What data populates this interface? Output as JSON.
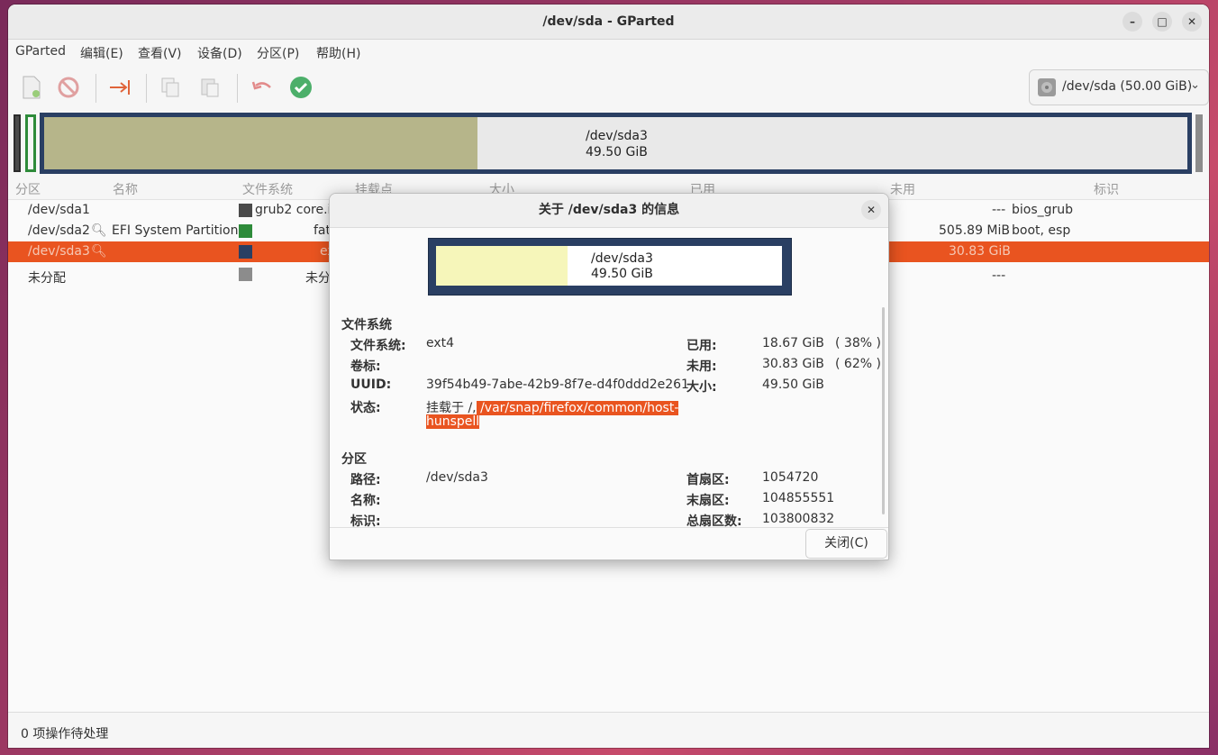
{
  "window": {
    "title": "/dev/sda - GParted",
    "minimize": "–",
    "maximize": "□",
    "close": "✕"
  },
  "menu": [
    "GParted",
    "编辑(E)",
    "查看(V)",
    "设备(D)",
    "分区(P)",
    "帮助(H)"
  ],
  "device_selector": {
    "label": "/dev/sda (50.00 GiB)"
  },
  "disk_map": {
    "partition_name": "/dev/sda3",
    "partition_size": "49.50 GiB"
  },
  "columns": [
    "分区",
    "名称",
    "文件系统",
    "挂载点",
    "大小",
    "已用",
    "未用",
    "标识"
  ],
  "rows": [
    {
      "partition": "/dev/sda1",
      "name": "",
      "fs": "grub2 core.i",
      "unused": "---",
      "flags": "bios_grub",
      "color": "#4a4a4a"
    },
    {
      "partition": "/dev/sda2",
      "name": "EFI System Partition",
      "fs": "fat",
      "unused": "505.89 MiB",
      "flags": "boot, esp",
      "color": "#2e8b3a"
    },
    {
      "partition": "/dev/sda3",
      "name": "",
      "fs": "ex",
      "unused": "30.83 GiB",
      "flags": "",
      "color": "#2a3f63"
    },
    {
      "partition": "未分配",
      "name": "",
      "fs": "未分",
      "unused": "---",
      "flags": "",
      "color": "#8c8c8c"
    }
  ],
  "status_bar": "0 项操作待处理",
  "dialog": {
    "title": "关于 /dev/sda3 的信息",
    "close_icon": "✕",
    "bar_name": "/dev/sda3",
    "bar_size": "49.50 GiB",
    "used_fraction": 0.38,
    "fs_section": "文件系统",
    "fs_label": "文件系统:",
    "fs_value": "ext4",
    "volume_label": "卷标:",
    "uuid_label": "UUID:",
    "uuid_value": "39f54b49-7abe-42b9-8f7e-d4f0ddd2e261",
    "status_label": "状态:",
    "status_prefix": "挂载于 /,",
    "status_highlight_1": " /var/snap/firefox/common/host-",
    "status_highlight_2": "hunspell",
    "used_label": "已用:",
    "used_value": "18.67 GiB",
    "used_pct": "( 38% )",
    "unused_label": "未用:",
    "unused_value": "30.83 GiB",
    "unused_pct": "( 62% )",
    "size_label": "大小:",
    "size_value": "49.50 GiB",
    "part_section": "分区",
    "path_label": "路径:",
    "path_value": "/dev/sda3",
    "name_label": "名称:",
    "flags_label": "标识:",
    "first_sector_label": "首扇区:",
    "first_sector_value": "1054720",
    "last_sector_label": "末扇区:",
    "last_sector_value": "104855551",
    "total_sectors_label": "总扇区数:",
    "total_sectors_value": "103800832",
    "close_button": "关闭(C)"
  }
}
